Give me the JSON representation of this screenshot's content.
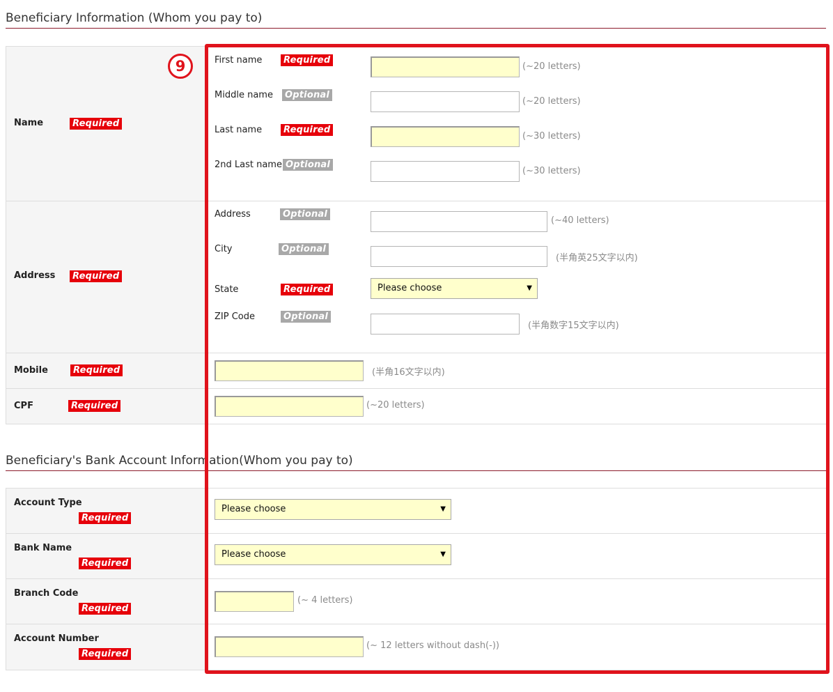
{
  "sections": {
    "beneficiary_title": "Beneficiary Information (Whom you pay to)",
    "bank_title": "Beneficiary's Bank Account Information(Whom you pay to)"
  },
  "badges": {
    "required": "Required",
    "optional": "Optional"
  },
  "step_number": "9",
  "name": {
    "label": "Name",
    "first_name": {
      "label": "First name",
      "value": "",
      "hint": "(~20 letters)"
    },
    "middle_name": {
      "label": "Middle name",
      "value": "",
      "hint": "(~20 letters)"
    },
    "last_name": {
      "label": "Last name",
      "value": "",
      "hint": "(~30 letters)"
    },
    "second_last_name": {
      "label": "2nd Last name",
      "value": "",
      "hint": "(~30 letters)"
    }
  },
  "address": {
    "label": "Address",
    "address": {
      "label": "Address",
      "value": "",
      "hint": "(~40 letters)"
    },
    "city": {
      "label": "City",
      "value": "",
      "hint": "(半角英25文字以内)"
    },
    "state": {
      "label": "State",
      "selected": "Please choose"
    },
    "zip": {
      "label": "ZIP Code",
      "value": "",
      "hint": "(半角数字15文字以内)"
    }
  },
  "mobile": {
    "label": "Mobile",
    "value": "",
    "hint": "(半角16文字以内)"
  },
  "cpf": {
    "label": "CPF",
    "value": "",
    "hint": "(~20 letters)"
  },
  "account_type": {
    "label": "Account Type",
    "selected": "Please choose"
  },
  "bank_name": {
    "label": "Bank Name",
    "selected": "Please choose"
  },
  "branch_code": {
    "label": "Branch Code",
    "value": "",
    "hint": "(~ 4 letters)"
  },
  "account_number": {
    "label": "Account Number",
    "value": "",
    "hint": "(~ 12 letters without dash(-))"
  },
  "colors": {
    "required": "#e6000a",
    "optional": "#a8a8a8",
    "highlight": "#e0131c",
    "field_fill": "#ffffcc"
  }
}
